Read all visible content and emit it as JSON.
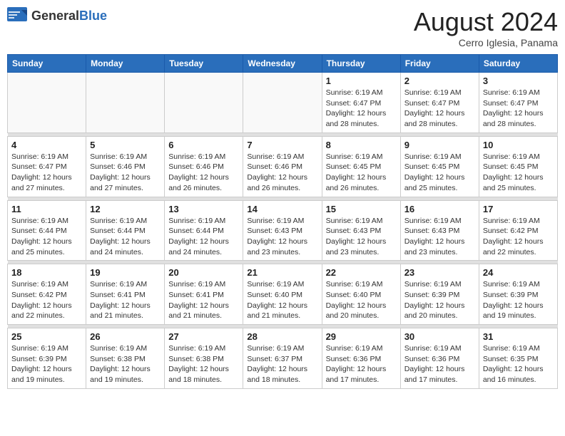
{
  "header": {
    "logo_general": "General",
    "logo_blue": "Blue",
    "title": "August 2024",
    "subtitle": "Cerro Iglesia, Panama"
  },
  "weekdays": [
    "Sunday",
    "Monday",
    "Tuesday",
    "Wednesday",
    "Thursday",
    "Friday",
    "Saturday"
  ],
  "weeks": [
    [
      {
        "day": "",
        "info": ""
      },
      {
        "day": "",
        "info": ""
      },
      {
        "day": "",
        "info": ""
      },
      {
        "day": "",
        "info": ""
      },
      {
        "day": "1",
        "info": "Sunrise: 6:19 AM\nSunset: 6:47 PM\nDaylight: 12 hours\nand 28 minutes."
      },
      {
        "day": "2",
        "info": "Sunrise: 6:19 AM\nSunset: 6:47 PM\nDaylight: 12 hours\nand 28 minutes."
      },
      {
        "day": "3",
        "info": "Sunrise: 6:19 AM\nSunset: 6:47 PM\nDaylight: 12 hours\nand 28 minutes."
      }
    ],
    [
      {
        "day": "4",
        "info": "Sunrise: 6:19 AM\nSunset: 6:47 PM\nDaylight: 12 hours\nand 27 minutes."
      },
      {
        "day": "5",
        "info": "Sunrise: 6:19 AM\nSunset: 6:46 PM\nDaylight: 12 hours\nand 27 minutes."
      },
      {
        "day": "6",
        "info": "Sunrise: 6:19 AM\nSunset: 6:46 PM\nDaylight: 12 hours\nand 26 minutes."
      },
      {
        "day": "7",
        "info": "Sunrise: 6:19 AM\nSunset: 6:46 PM\nDaylight: 12 hours\nand 26 minutes."
      },
      {
        "day": "8",
        "info": "Sunrise: 6:19 AM\nSunset: 6:45 PM\nDaylight: 12 hours\nand 26 minutes."
      },
      {
        "day": "9",
        "info": "Sunrise: 6:19 AM\nSunset: 6:45 PM\nDaylight: 12 hours\nand 25 minutes."
      },
      {
        "day": "10",
        "info": "Sunrise: 6:19 AM\nSunset: 6:45 PM\nDaylight: 12 hours\nand 25 minutes."
      }
    ],
    [
      {
        "day": "11",
        "info": "Sunrise: 6:19 AM\nSunset: 6:44 PM\nDaylight: 12 hours\nand 25 minutes."
      },
      {
        "day": "12",
        "info": "Sunrise: 6:19 AM\nSunset: 6:44 PM\nDaylight: 12 hours\nand 24 minutes."
      },
      {
        "day": "13",
        "info": "Sunrise: 6:19 AM\nSunset: 6:44 PM\nDaylight: 12 hours\nand 24 minutes."
      },
      {
        "day": "14",
        "info": "Sunrise: 6:19 AM\nSunset: 6:43 PM\nDaylight: 12 hours\nand 23 minutes."
      },
      {
        "day": "15",
        "info": "Sunrise: 6:19 AM\nSunset: 6:43 PM\nDaylight: 12 hours\nand 23 minutes."
      },
      {
        "day": "16",
        "info": "Sunrise: 6:19 AM\nSunset: 6:43 PM\nDaylight: 12 hours\nand 23 minutes."
      },
      {
        "day": "17",
        "info": "Sunrise: 6:19 AM\nSunset: 6:42 PM\nDaylight: 12 hours\nand 22 minutes."
      }
    ],
    [
      {
        "day": "18",
        "info": "Sunrise: 6:19 AM\nSunset: 6:42 PM\nDaylight: 12 hours\nand 22 minutes."
      },
      {
        "day": "19",
        "info": "Sunrise: 6:19 AM\nSunset: 6:41 PM\nDaylight: 12 hours\nand 21 minutes."
      },
      {
        "day": "20",
        "info": "Sunrise: 6:19 AM\nSunset: 6:41 PM\nDaylight: 12 hours\nand 21 minutes."
      },
      {
        "day": "21",
        "info": "Sunrise: 6:19 AM\nSunset: 6:40 PM\nDaylight: 12 hours\nand 21 minutes."
      },
      {
        "day": "22",
        "info": "Sunrise: 6:19 AM\nSunset: 6:40 PM\nDaylight: 12 hours\nand 20 minutes."
      },
      {
        "day": "23",
        "info": "Sunrise: 6:19 AM\nSunset: 6:39 PM\nDaylight: 12 hours\nand 20 minutes."
      },
      {
        "day": "24",
        "info": "Sunrise: 6:19 AM\nSunset: 6:39 PM\nDaylight: 12 hours\nand 19 minutes."
      }
    ],
    [
      {
        "day": "25",
        "info": "Sunrise: 6:19 AM\nSunset: 6:39 PM\nDaylight: 12 hours\nand 19 minutes."
      },
      {
        "day": "26",
        "info": "Sunrise: 6:19 AM\nSunset: 6:38 PM\nDaylight: 12 hours\nand 19 minutes."
      },
      {
        "day": "27",
        "info": "Sunrise: 6:19 AM\nSunset: 6:38 PM\nDaylight: 12 hours\nand 18 minutes."
      },
      {
        "day": "28",
        "info": "Sunrise: 6:19 AM\nSunset: 6:37 PM\nDaylight: 12 hours\nand 18 minutes."
      },
      {
        "day": "29",
        "info": "Sunrise: 6:19 AM\nSunset: 6:36 PM\nDaylight: 12 hours\nand 17 minutes."
      },
      {
        "day": "30",
        "info": "Sunrise: 6:19 AM\nSunset: 6:36 PM\nDaylight: 12 hours\nand 17 minutes."
      },
      {
        "day": "31",
        "info": "Sunrise: 6:19 AM\nSunset: 6:35 PM\nDaylight: 12 hours\nand 16 minutes."
      }
    ]
  ]
}
